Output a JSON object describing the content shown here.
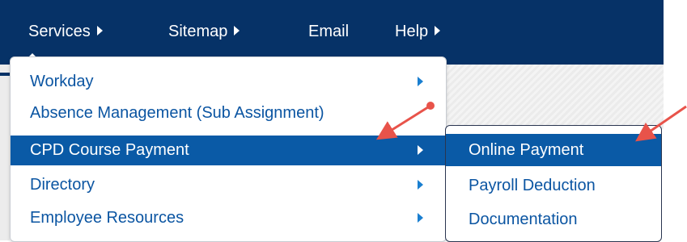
{
  "nav": {
    "items": [
      {
        "label": "Services",
        "has_arrow": true
      },
      {
        "label": "Sitemap",
        "has_arrow": true
      },
      {
        "label": "Email",
        "has_arrow": false
      },
      {
        "label": "Help",
        "has_arrow": true
      }
    ]
  },
  "dropdown": {
    "items": [
      {
        "label": "Workday",
        "has_arrow": true
      },
      {
        "label": "Absence Management (Sub Assignment)",
        "has_arrow": false
      },
      {
        "label": "CPD Course Payment",
        "has_arrow": true,
        "active": true
      },
      {
        "label": "Directory",
        "has_arrow": true
      },
      {
        "label": "Employee Resources",
        "has_arrow": true
      }
    ]
  },
  "submenu": {
    "items": [
      {
        "label": "Online Payment",
        "active": true
      },
      {
        "label": "Payroll Deduction"
      },
      {
        "label": "Documentation"
      }
    ]
  },
  "colors": {
    "navbar": "#063267",
    "highlight": "#0a5aa6",
    "link": "#0b55a2",
    "annotation_arrow": "#e8534a"
  },
  "icons": {
    "nav_arrow": "triangle-right-icon",
    "menu_arrow": "triangle-right-icon",
    "annotation": "red-arrow-icon"
  }
}
